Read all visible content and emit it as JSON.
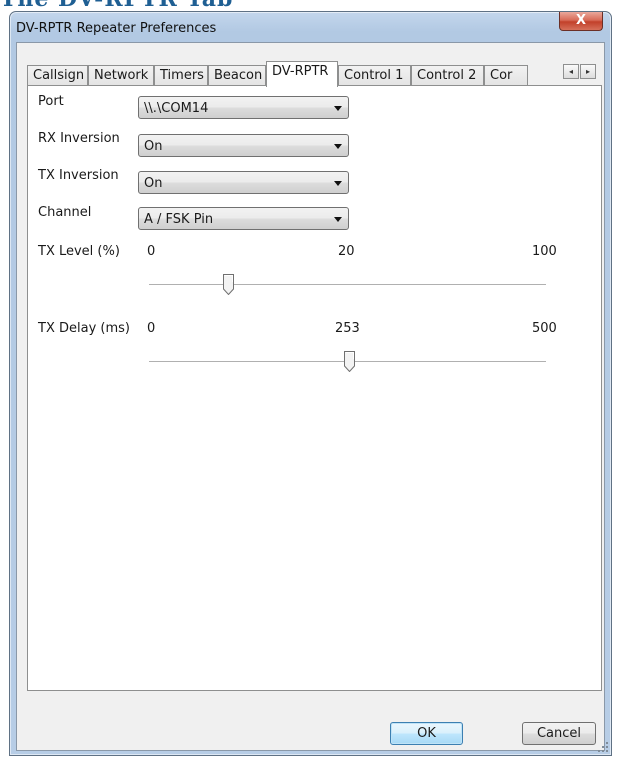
{
  "page": {
    "heading": "The DV-RPTR Tab"
  },
  "window": {
    "title": "DV-RPTR Repeater Preferences",
    "close_glyph": "X",
    "close_icon": "close-icon"
  },
  "tabs": [
    {
      "label": "Callsign",
      "active": false
    },
    {
      "label": "Network",
      "active": false
    },
    {
      "label": "Timers",
      "active": false
    },
    {
      "label": "Beacon",
      "active": false
    },
    {
      "label": "DV-RPTR",
      "active": true
    },
    {
      "label": "Control 1",
      "active": false
    },
    {
      "label": "Control 2",
      "active": false
    },
    {
      "label": "Cor",
      "active": false
    }
  ],
  "tab_scroll": {
    "left_glyph": "◂",
    "right_glyph": "▸"
  },
  "form": {
    "port": {
      "label": "Port",
      "value": "\\\\.\\COM14"
    },
    "rx_inversion": {
      "label": "RX Inversion",
      "value": "On"
    },
    "tx_inversion": {
      "label": "TX Inversion",
      "value": "On"
    },
    "channel": {
      "label": "Channel",
      "value": "A / FSK Pin"
    },
    "tx_level": {
      "label": "TX Level (%)",
      "min": "0",
      "value": "20",
      "max": "100",
      "fraction": 0.2
    },
    "tx_delay": {
      "label": "TX Delay (ms)",
      "min": "0",
      "value": "253",
      "max": "500",
      "fraction": 0.506
    }
  },
  "buttons": {
    "ok": "OK",
    "cancel": "Cancel"
  },
  "colors": {
    "heading": "#1f5f93",
    "title_bar": "#b7cde6",
    "close_button": "#c2402a",
    "default_button_border": "#3c7fb1"
  }
}
